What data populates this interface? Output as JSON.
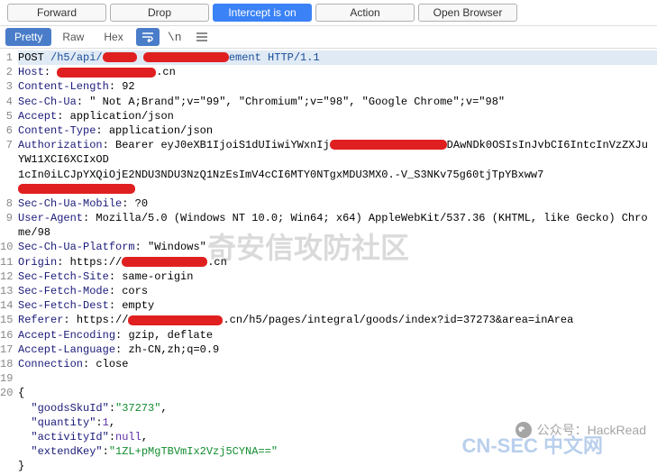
{
  "toolbar": {
    "forward": "Forward",
    "drop": "Drop",
    "intercept": "Intercept is on",
    "action": "Action",
    "open_browser": "Open Browser"
  },
  "subbar": {
    "pretty": "Pretty",
    "raw": "Raw",
    "hex": "Hex"
  },
  "request": {
    "method": "POST",
    "path_prefix": "/h5/api/",
    "path_suffix": "ement HTTP/1.1",
    "host_label": "Host",
    "host_suffix": ".cn",
    "cl_label": "Content-Length",
    "cl_value": "92",
    "scu_label": "Sec-Ch-Ua",
    "scu_value": "\" Not A;Brand\";v=\"99\", \"Chromium\";v=\"98\", \"Google Chrome\";v=\"98\"",
    "accept_label": "Accept",
    "accept_value": "application/json",
    "ct_label": "Content-Type",
    "ct_value": "application/json",
    "auth_label": "Authorization",
    "auth_prefix": "Bearer eyJ0eXB1IjoiS1dUIiwiYWxnIj",
    "auth_mid": "DAwNDk0OSIsInJvbCI6IntcInVzZXJuYW11XCI6XCIxOD",
    "auth_tail": "1cIn0iLCJpYXQiOjE2NDU3NDU3NzQ1NzEsImV4cCI6MTY0NTgxMDU3MX0.-V_S3NKv75g60tjTpYBxww7",
    "scum_label": "Sec-Ch-Ua-Mobile",
    "scum_value": "?0",
    "ua_label": "User-Agent",
    "ua_value": "Mozilla/5.0 (Windows NT 10.0; Win64; x64) AppleWebKit/537.36 (KHTML, like Gecko) Chrome/98",
    "scup_label": "Sec-Ch-Ua-Platform",
    "scup_value": "\"Windows\"",
    "origin_label": "Origin",
    "origin_prefix": "https://",
    "origin_suffix": ".cn",
    "sfs_label": "Sec-Fetch-Site",
    "sfs_value": "same-origin",
    "sfm_label": "Sec-Fetch-Mode",
    "sfm_value": "cors",
    "sfd_label": "Sec-Fetch-Dest",
    "sfd_value": "empty",
    "ref_label": "Referer",
    "ref_prefix": "https://",
    "ref_suffix": ".cn/h5/pages/integral/goods/index?id=37273&area=inArea",
    "ae_label": "Accept-Encoding",
    "ae_value": "gzip, deflate",
    "al_label": "Accept-Language",
    "al_value": "zh-CN,zh;q=0.9",
    "conn_label": "Connection",
    "conn_value": "close"
  },
  "body": {
    "open": "{",
    "k1": "\"goodsSkuId\"",
    "v1": "\"37273\"",
    "c": ",",
    "k2": "\"quantity\"",
    "v2": "1",
    "k3": "\"activityId\"",
    "v3": "null",
    "k4": "\"extendKey\"",
    "v4": "\"1ZL+pMgTBVmIx2Vzj5CYNA==\"",
    "close": "}"
  },
  "watermarks": {
    "main": "奇安信攻防社区",
    "bottom": "CN-SEC 中文网",
    "wechat": "公众号：HackRead"
  }
}
